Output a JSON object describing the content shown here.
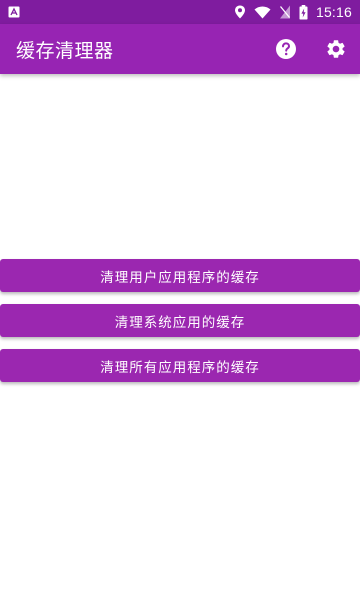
{
  "status_bar": {
    "time": "15:16",
    "icons": [
      "app-notification-icon",
      "location-icon",
      "wifi-icon",
      "no-sim-icon",
      "battery-charging-icon"
    ]
  },
  "app_bar": {
    "title": "缓存清理器",
    "actions": [
      "help-icon",
      "settings-icon"
    ]
  },
  "buttons": {
    "clean_user": "清理用户应用程序的缓存",
    "clean_system": "清理系统应用的缓存",
    "clean_all": "清理所有应用程序的缓存"
  },
  "colors": {
    "status_bar": "#7f1c9f",
    "app_bar": "#9724b3",
    "button": "#9b27b0",
    "background": "#ffffff"
  }
}
